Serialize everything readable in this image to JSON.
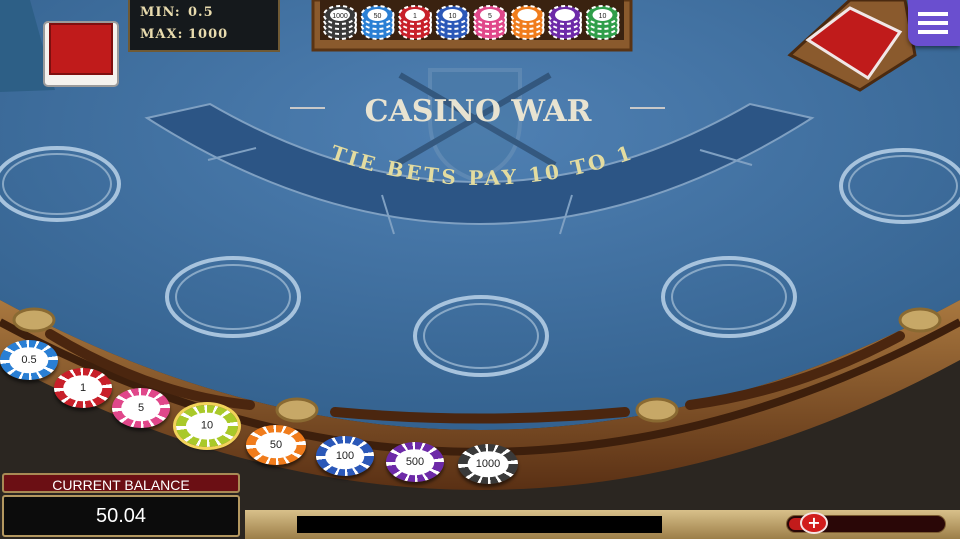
{
  "table": {
    "title": "CASINO WAR",
    "subtitle": "TIE BETS PAY 10 TO 1"
  },
  "limits": {
    "min_label": "MIN:",
    "min_value": "0.5",
    "max_label": "MAX:",
    "max_value": "1000"
  },
  "rack_chips": [
    "1000",
    "50",
    "1",
    "10",
    "5",
    "",
    "",
    "10"
  ],
  "bet_chips": [
    {
      "label": "0.5",
      "color": "#2a7fd4"
    },
    {
      "label": "1",
      "color": "#c8202a"
    },
    {
      "label": "5",
      "color": "#e0478a"
    },
    {
      "label": "10",
      "color": "#a9c92a"
    },
    {
      "label": "50",
      "color": "#f07c1c"
    },
    {
      "label": "100",
      "color": "#2b58b8"
    },
    {
      "label": "500",
      "color": "#6d2aa8"
    },
    {
      "label": "1000",
      "color": "#3a3a3a"
    }
  ],
  "balance": {
    "label": "CURRENT BALANCE",
    "value": "50.04"
  },
  "volume": {
    "level": 0.15
  },
  "icons": {
    "menu": "menu-icon",
    "volume": "plus-icon"
  },
  "colors": {
    "felt": "#3f6f9f",
    "felt_dark": "#2c5585",
    "wood": "#6b3f1f",
    "accent_gold": "#d8c08a"
  }
}
